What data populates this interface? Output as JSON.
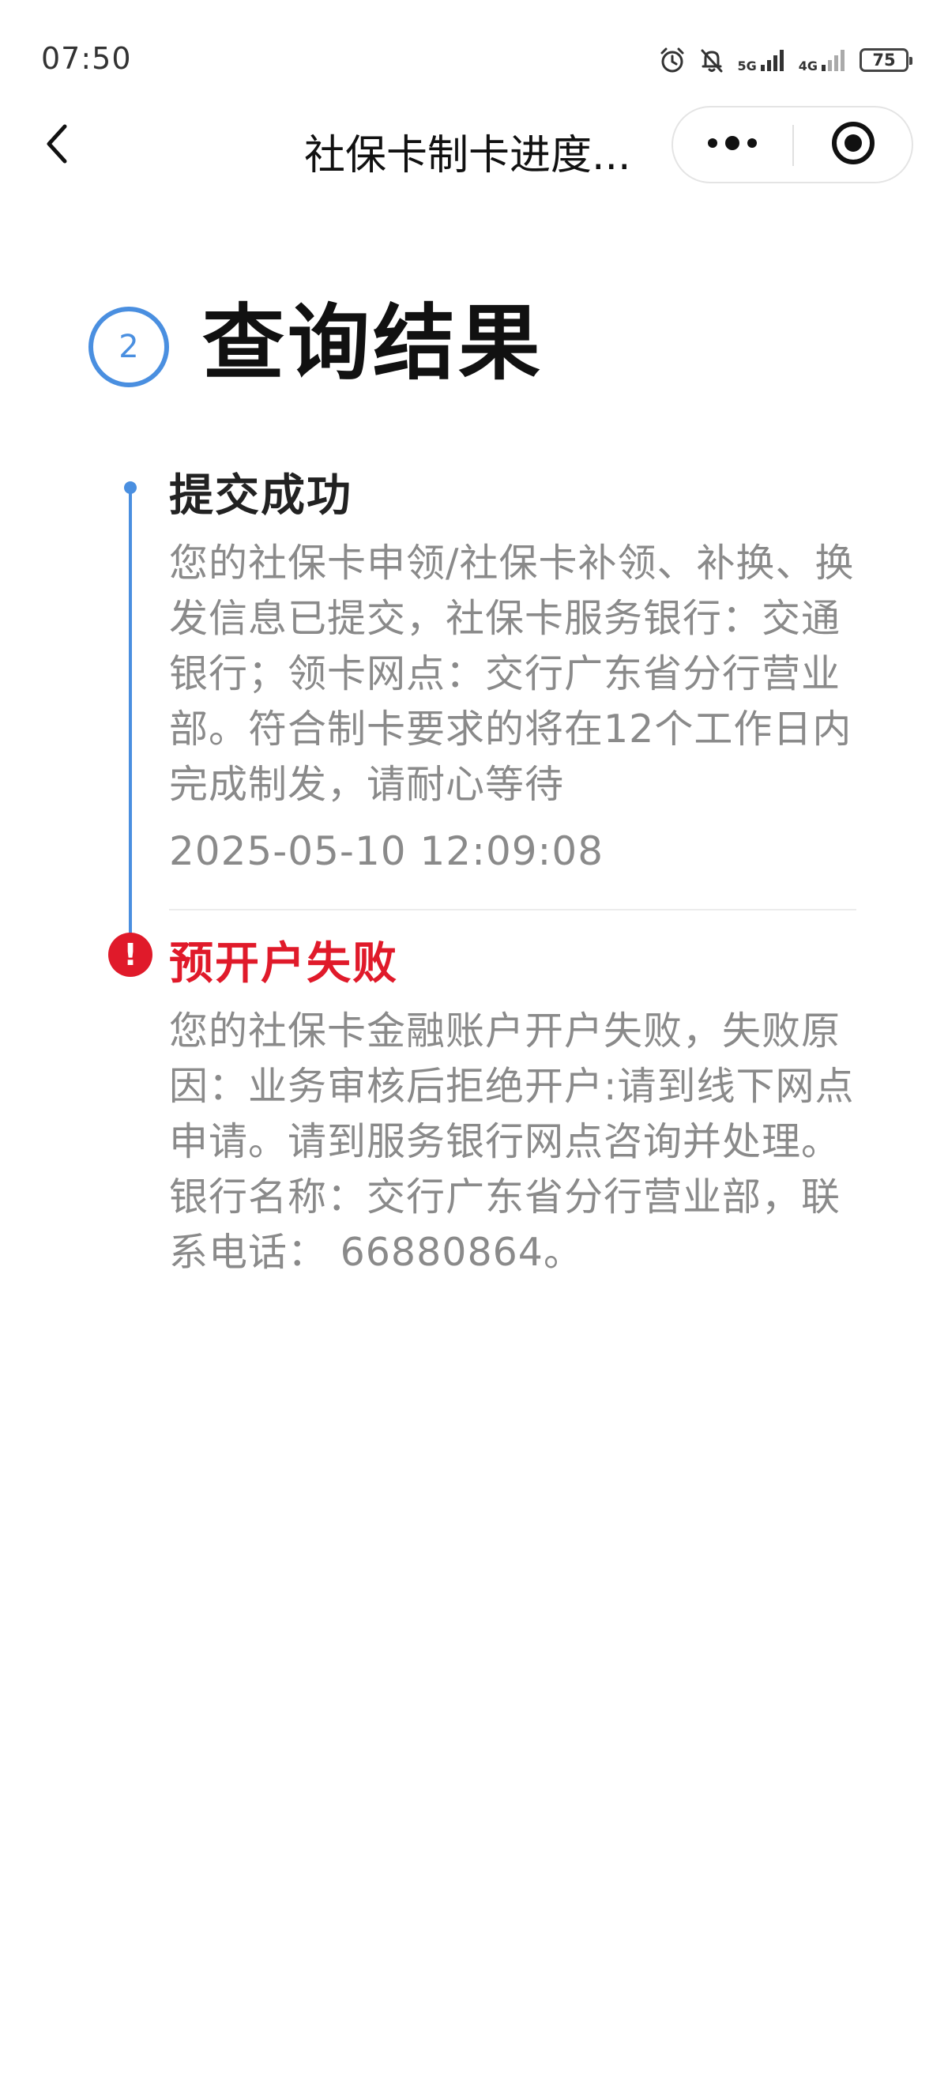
{
  "status_bar": {
    "time": "07:50",
    "network_1": "5G",
    "network_2": "4G",
    "battery": "75",
    "icons": [
      "alarm-icon",
      "mute-bell-icon",
      "signal-5g-icon",
      "signal-4g-icon",
      "battery-icon"
    ]
  },
  "nav": {
    "title": "社保卡制卡进度...",
    "back_icon": "chevron-left-icon",
    "more_icon": "more-dots-icon",
    "close_icon": "target-circle-icon"
  },
  "section": {
    "step_number": "2",
    "title": "查询结果"
  },
  "colors": {
    "accent_blue": "#4a8fe0",
    "error_red": "#e01a2a",
    "text_gray": "#8a8a8a"
  },
  "events": [
    {
      "title": "提交成功",
      "description": "您的社保卡申领/社保卡补领、补换、换发信息已提交，社保卡服务银行：交通银行；领卡网点：交行广东省分行营业部。符合制卡要求的将在12个工作日内完成制发，请耐心等待",
      "time": "2025-05-10 12:09:08",
      "status": "success"
    },
    {
      "title": "预开户失败",
      "description": "您的社保卡金融账户开户失败，失败原因：业务审核后拒绝开户:请到线下网点申请。请到服务银行网点咨询并处理。银行名称：交行广东省分行营业部，联系电话： 66880864。",
      "status": "error",
      "error_symbol": "!"
    }
  ]
}
